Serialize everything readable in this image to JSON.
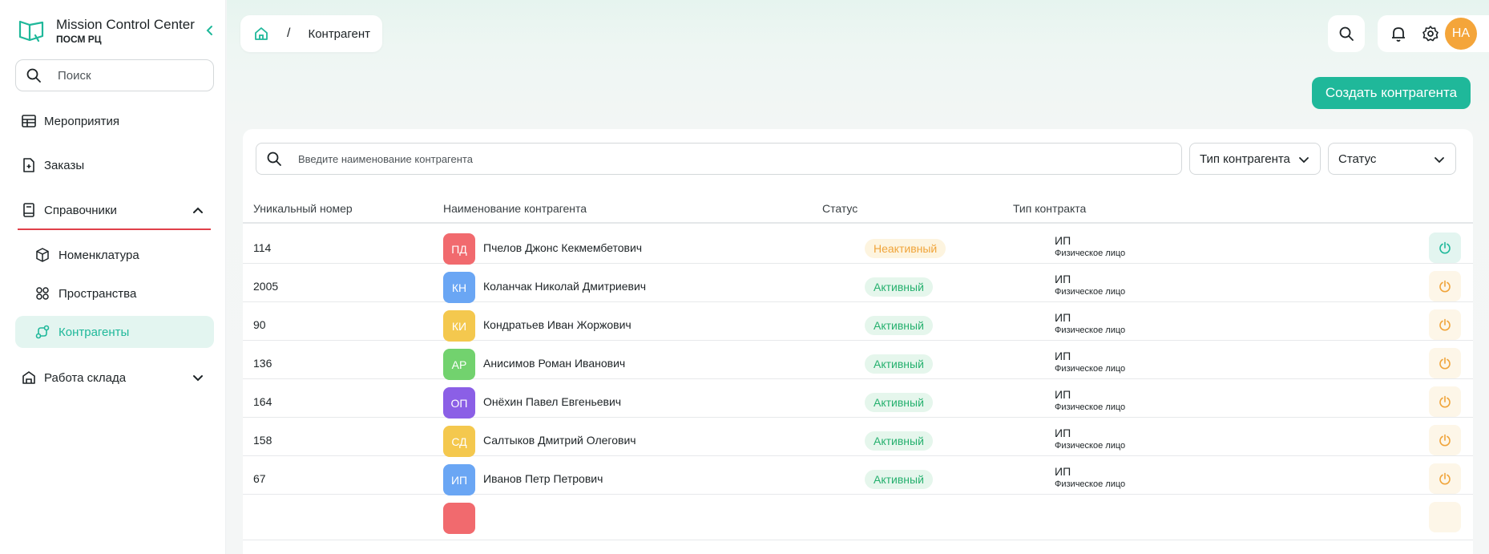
{
  "brand": {
    "title": "Mission Control Center",
    "subtitle": "ПОСМ РЦ"
  },
  "sidebar": {
    "search_placeholder": "Поиск",
    "items": [
      {
        "label": "Мероприятия",
        "icon": "table-icon"
      },
      {
        "label": "Заказы",
        "icon": "add-document-icon"
      },
      {
        "label": "Справочники",
        "icon": "book-icon",
        "expanded": true
      },
      {
        "label": "Номенклатура",
        "icon": "box-icon"
      },
      {
        "label": "Пространства",
        "icon": "grid-icon"
      },
      {
        "label": "Контрагенты",
        "icon": "flow-icon",
        "active": true
      },
      {
        "label": "Работа склада",
        "icon": "warehouse-icon"
      }
    ]
  },
  "breadcrumb": {
    "separator": "/",
    "current": "Контрагент"
  },
  "user": {
    "initials": "НА"
  },
  "actions": {
    "create_label": "Создать контрагента"
  },
  "filters": {
    "search_placeholder": "Введите наименование контрагента",
    "type_label": "Тип контрагента",
    "status_label": "Статус"
  },
  "table": {
    "headers": [
      "Уникальный номер",
      "Наименование контрагента",
      "Статус",
      "Тип контракта"
    ],
    "rows": [
      {
        "id": "114",
        "initials": "ПД",
        "name": "Пчелов Джонс Кекмембетович",
        "status": "Неактивный",
        "type": "ИП",
        "subtype": "Физическое лицо"
      },
      {
        "id": "2005",
        "initials": "КН",
        "name": "Коланчак Николай Дмитриевич",
        "status": "Активный",
        "type": "ИП",
        "subtype": "Физическое лицо"
      },
      {
        "id": "90",
        "initials": "КИ",
        "name": "Кондратьев Иван Жоржович",
        "status": "Активный",
        "type": "ИП",
        "subtype": "Физическое лицо"
      },
      {
        "id": "136",
        "initials": "АР",
        "name": "Анисимов Роман Иванович",
        "status": "Активный",
        "type": "ИП",
        "subtype": "Физическое лицо"
      },
      {
        "id": "164",
        "initials": "ОП",
        "name": "Онёхин Павел Евгеньевич",
        "status": "Активный",
        "type": "ИП",
        "subtype": "Физическое лицо"
      },
      {
        "id": "158",
        "initials": "СД",
        "name": "Салтыков Дмитрий Олегович",
        "status": "Активный",
        "type": "ИП",
        "subtype": "Физическое лицо"
      },
      {
        "id": "67",
        "initials": "ИП",
        "name": "Иванов Петр Петрович",
        "status": "Активный",
        "type": "ИП",
        "subtype": "Физическое лицо"
      }
    ]
  },
  "colors": {
    "accent": "#1fb89a",
    "avatar_colors": [
      "#f16a6e",
      "#6aa6f4",
      "#f4c84e",
      "#72d26e",
      "#8b5fe6",
      "#f4c84e",
      "#6aa6f4"
    ],
    "status_active": "#25b06e",
    "status_inactive": "#f0a43a",
    "user_avatar": "#f4a53a"
  }
}
